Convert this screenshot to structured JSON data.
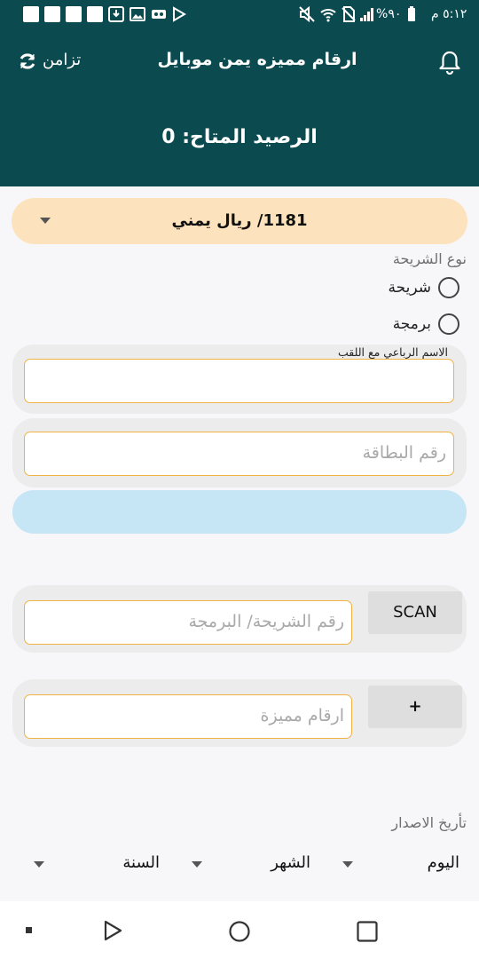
{
  "status_bar": {
    "time": "٥:١٢ م",
    "battery": "%٩٠"
  },
  "header": {
    "title": "ارقام مميزه يمن موبايل",
    "sync_label": "تزامن",
    "balance": "الرصيد المتاح: 0"
  },
  "currency": {
    "selected": "1181/ ريال يمني"
  },
  "sim_type": {
    "label": "نوع الشريحة",
    "options": [
      "شريحة",
      "برمجة"
    ]
  },
  "form": {
    "name_label": "الاسم  الرباعي مع اللقب",
    "name_value": "",
    "card_placeholder": "رقم البطاقة",
    "sim_placeholder": "رقم الشريحة/ البرمجة",
    "scan_label": "SCAN",
    "special_placeholder": "ارقام مميزة",
    "add_label": "+"
  },
  "issue_date": {
    "label": "تأريخ الاصدار",
    "day": "اليوم",
    "month": "الشهر",
    "year": "السنة"
  },
  "colors": {
    "header_bg": "#0b4b50",
    "currency_bg": "#fde3bd",
    "info_bar": "#c6e6f6",
    "field_border": "#f0b245"
  }
}
